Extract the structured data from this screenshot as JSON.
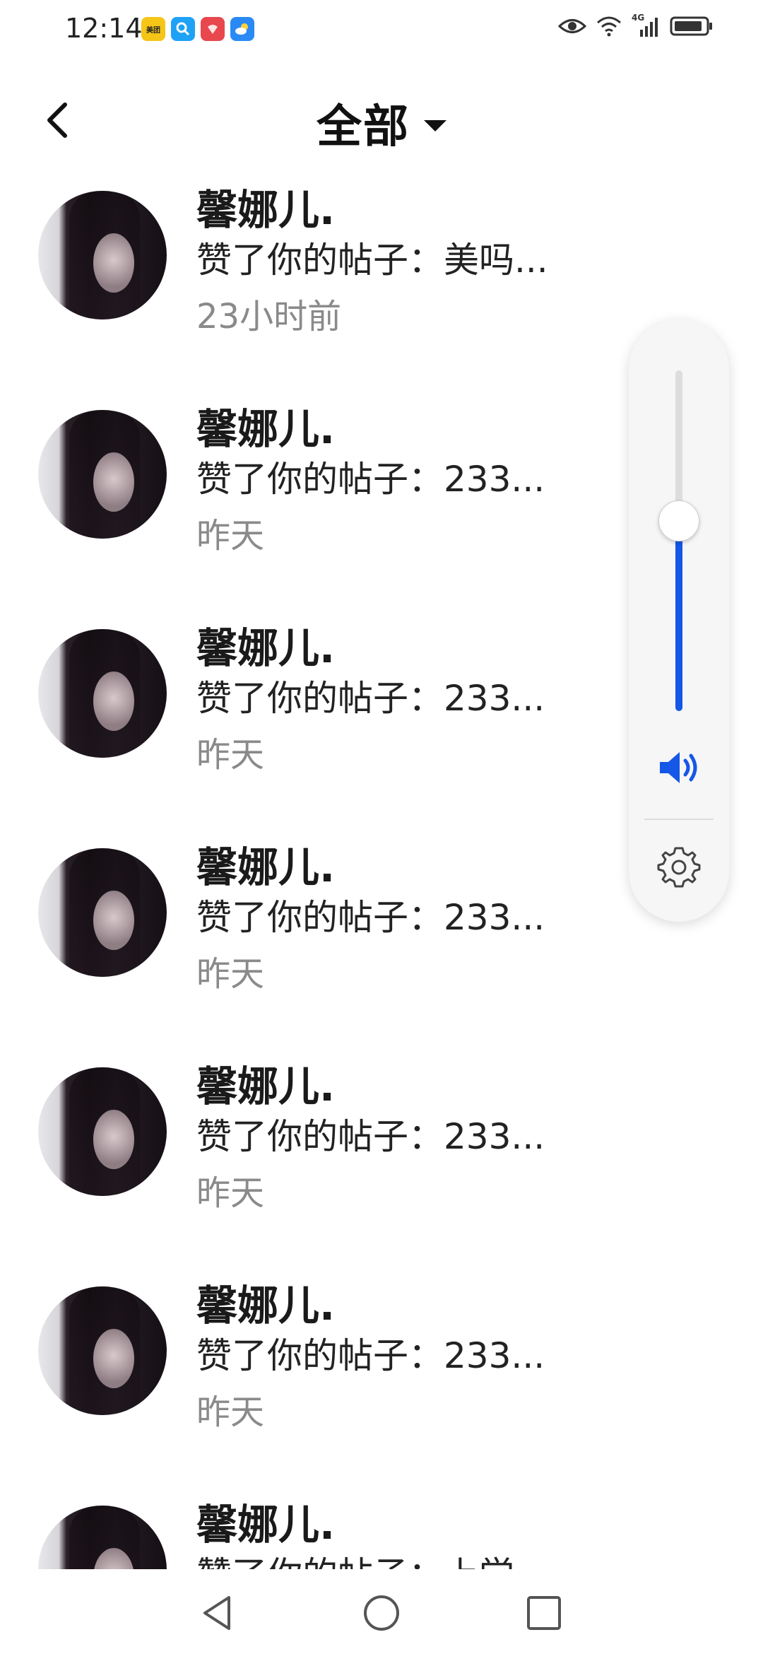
{
  "status_bar": {
    "time": "12:14",
    "apps": [
      {
        "name": "meituan-icon",
        "label": "美团",
        "color": "#f5c518"
      },
      {
        "name": "search-app-icon",
        "label": "",
        "color": "#1fa2f5"
      },
      {
        "name": "huawei-app-icon",
        "label": "",
        "color": "#e8474e"
      },
      {
        "name": "weather-app-icon",
        "label": "",
        "color": "#2a8af5"
      }
    ],
    "network": "4G"
  },
  "header": {
    "title": "全部"
  },
  "notifications": [
    {
      "user": "馨娜儿.",
      "action": "赞了你的帖子：美吗...",
      "time": "23小时前"
    },
    {
      "user": "馨娜儿.",
      "action": "赞了你的帖子：233...",
      "time": "昨天"
    },
    {
      "user": "馨娜儿.",
      "action": "赞了你的帖子：233...",
      "time": "昨天"
    },
    {
      "user": "馨娜儿.",
      "action": "赞了你的帖子：233...",
      "time": "昨天"
    },
    {
      "user": "馨娜儿.",
      "action": "赞了你的帖子：233...",
      "time": "昨天"
    },
    {
      "user": "馨娜儿.",
      "action": "赞了你的帖子：233...",
      "time": "昨天"
    },
    {
      "user": "馨娜儿.",
      "action": "赞了你的帖子：上学",
      "time": ""
    }
  ],
  "volume": {
    "level_fraction": 0.56,
    "accent_color": "#1557e6"
  }
}
